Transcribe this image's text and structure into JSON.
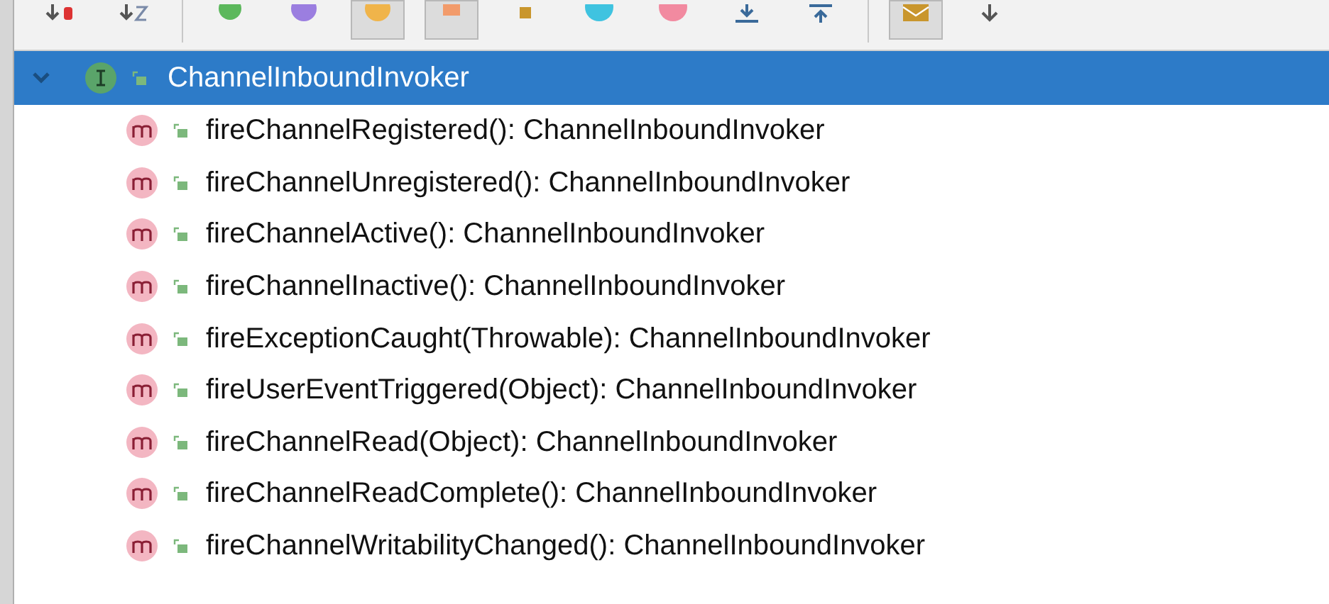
{
  "toolbar": {
    "buttons": [
      {
        "kind": "sort-visibility",
        "selected": false
      },
      {
        "kind": "sort-alpha",
        "selected": false
      },
      {
        "kind": "divider"
      },
      {
        "kind": "circle-green",
        "selected": false
      },
      {
        "kind": "circle-purple",
        "selected": false
      },
      {
        "kind": "circle-orange",
        "selected": true
      },
      {
        "kind": "square-orange",
        "selected": true
      },
      {
        "kind": "square-brown",
        "selected": false
      },
      {
        "kind": "circle-cyan",
        "selected": false
      },
      {
        "kind": "circle-pink",
        "selected": false
      },
      {
        "kind": "expand",
        "selected": false
      },
      {
        "kind": "collapse",
        "selected": false
      },
      {
        "kind": "divider"
      },
      {
        "kind": "envelope",
        "selected": true
      },
      {
        "kind": "down",
        "selected": false
      }
    ]
  },
  "tree": {
    "label": "ChannelInboundInvoker",
    "kind": "interface",
    "expanded": true,
    "selected": true,
    "children": [
      {
        "label": "fireChannelRegistered(): ChannelInboundInvoker",
        "kind": "method",
        "selected": false
      },
      {
        "label": "fireChannelUnregistered(): ChannelInboundInvoker",
        "kind": "method",
        "selected": false
      },
      {
        "label": "fireChannelActive(): ChannelInboundInvoker",
        "kind": "method",
        "selected": false
      },
      {
        "label": "fireChannelInactive(): ChannelInboundInvoker",
        "kind": "method",
        "selected": false
      },
      {
        "label": "fireExceptionCaught(Throwable): ChannelInboundInvoker",
        "kind": "method",
        "selected": false
      },
      {
        "label": "fireUserEventTriggered(Object): ChannelInboundInvoker",
        "kind": "method",
        "selected": false
      },
      {
        "label": "fireChannelRead(Object): ChannelInboundInvoker",
        "kind": "method",
        "selected": false
      },
      {
        "label": "fireChannelReadComplete(): ChannelInboundInvoker",
        "kind": "method",
        "selected": false
      },
      {
        "label": "fireChannelWritabilityChanged(): ChannelInboundInvoker",
        "kind": "method",
        "selected": false
      }
    ]
  }
}
